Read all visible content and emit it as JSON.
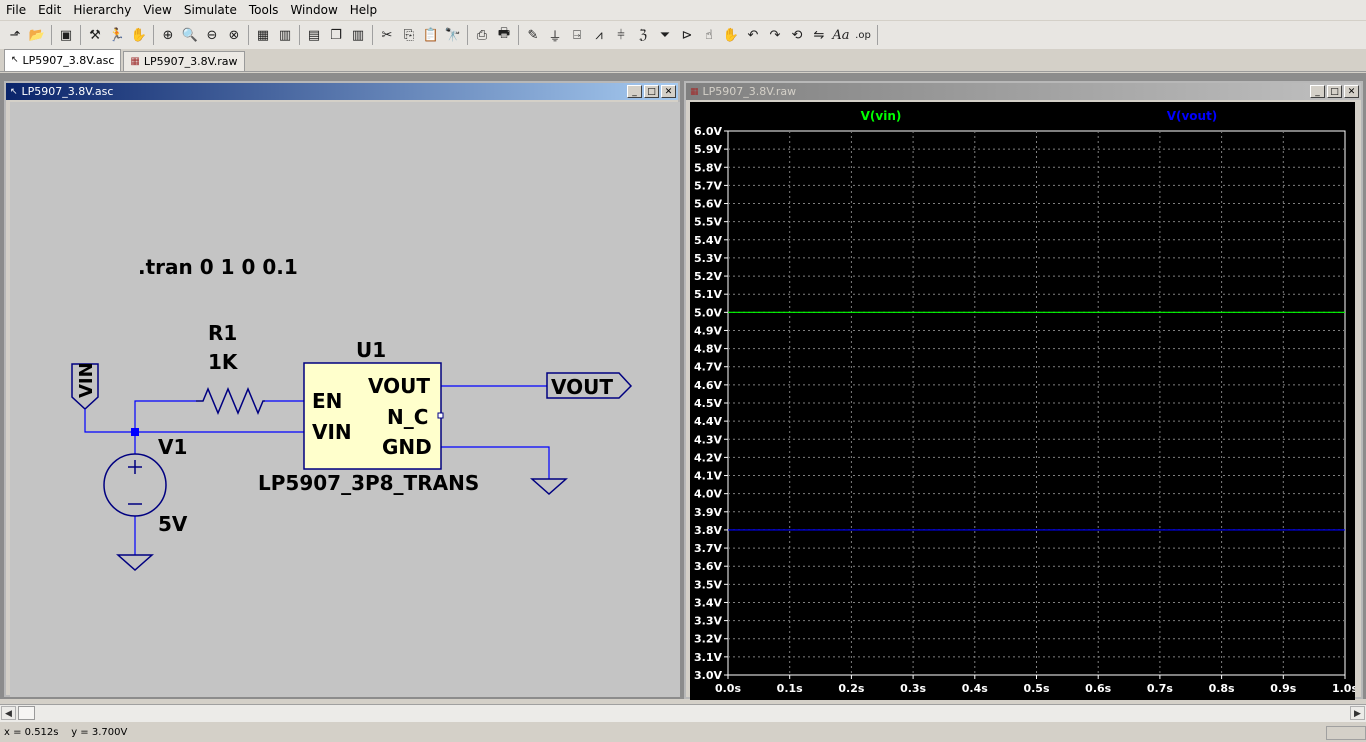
{
  "menubar": {
    "items": [
      "File",
      "Edit",
      "Hierarchy",
      "View",
      "Simulate",
      "Tools",
      "Window",
      "Help"
    ]
  },
  "toolbar": {
    "icons": [
      "new-schematic-icon",
      "open-file-icon",
      "save-icon",
      "control-panel-icon",
      "run-icon",
      "halt-icon",
      "zoom-in-icon",
      "pan-icon",
      "zoom-out-icon",
      "zoom-cancel-icon",
      "autorange-icon",
      "vertical-autorange-icon",
      "tile-horizontal-icon",
      "cascade-icon",
      "tile-vertical-icon",
      "cut-icon",
      "copy-icon",
      "paste-icon",
      "find-icon",
      "print-setup-icon",
      "print-icon",
      "wire-icon",
      "ground-icon",
      "label-net-icon",
      "resistor-icon",
      "capacitor-icon",
      "inductor-icon",
      "diode-icon",
      "component-icon",
      "move-icon",
      "drag-icon",
      "undo-icon",
      "redo-icon",
      "rotate-icon",
      "mirror-icon",
      "text-icon",
      "spice-directive-icon"
    ]
  },
  "tabs": [
    {
      "label": "LP5907_3.8V.asc",
      "icon": "schematic-icon"
    },
    {
      "label": "LP5907_3.8V.raw",
      "icon": "waveform-icon"
    }
  ],
  "schematic_window": {
    "title": "LP5907_3.8V.asc",
    "directive": ".tran 0 1 0 0.1",
    "r1_name": "R1",
    "r1_value": "1K",
    "u1_name": "U1",
    "u1_part": "LP5907_3P8_TRANS",
    "pin_en": "EN",
    "pin_vin": "VIN",
    "pin_vout": "VOUT",
    "pin_nc": "N_C",
    "pin_gnd": "GND",
    "v1_name": "V1",
    "v1_value": "5V",
    "label_vin": "VIN",
    "label_vout": "VOUT"
  },
  "plot_window": {
    "title": "LP5907_3.8V.raw"
  },
  "chart_data": {
    "type": "line",
    "x": [
      0.0,
      1.0
    ],
    "series": [
      {
        "name": "V(vin)",
        "values": [
          5.0,
          5.0
        ],
        "color": "#00ff00"
      },
      {
        "name": "V(vout)",
        "values": [
          3.8,
          3.8
        ],
        "color": "#0000ff"
      }
    ],
    "xlim": [
      0.0,
      1.0
    ],
    "ylim": [
      3.0,
      6.0
    ],
    "x_ticks": [
      "0.0s",
      "0.1s",
      "0.2s",
      "0.3s",
      "0.4s",
      "0.5s",
      "0.6s",
      "0.7s",
      "0.8s",
      "0.9s",
      "1.0s"
    ],
    "y_ticks": [
      "3.0V",
      "3.1V",
      "3.2V",
      "3.3V",
      "3.4V",
      "3.5V",
      "3.6V",
      "3.7V",
      "3.8V",
      "3.9V",
      "4.0V",
      "4.1V",
      "4.2V",
      "4.3V",
      "4.4V",
      "4.5V",
      "4.6V",
      "4.7V",
      "4.8V",
      "4.9V",
      "5.0V",
      "5.1V",
      "5.2V",
      "5.3V",
      "5.4V",
      "5.5V",
      "5.6V",
      "5.7V",
      "5.8V",
      "5.9V",
      "6.0V"
    ],
    "grid": true,
    "legend": "top"
  },
  "status": {
    "coords": "x = 0.512s    y = 3.700V"
  },
  "colors": {
    "trace_vin": "#00ff00",
    "trace_vout": "#0000ff",
    "wire": "#0000ff",
    "component": "#000080",
    "ic_fill": "#ffffcc",
    "plot_bg": "#000000",
    "grid": "#808080"
  }
}
